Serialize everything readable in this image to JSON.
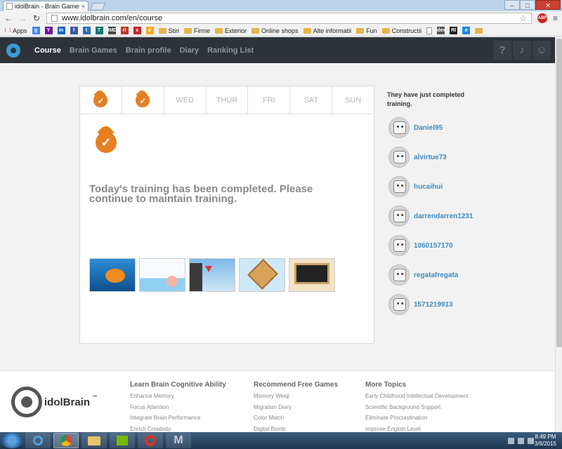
{
  "browser": {
    "tab_title": "idolBrain - Brain Games &",
    "tab_close": "×",
    "url": "www.idolbrain.com/en/course",
    "abp": "ABP",
    "win": {
      "minimize": "–",
      "maximize": "□",
      "close": "✕"
    }
  },
  "bookmarks": [
    {
      "label": "Apps",
      "kind": "apps"
    },
    {
      "label": "",
      "kind": "sq",
      "color": "#4285f4",
      "glyph": "g"
    },
    {
      "label": "",
      "kind": "sq",
      "color": "#6a1b9a",
      "glyph": "Y"
    },
    {
      "label": "",
      "kind": "sq",
      "color": "#1565c0",
      "glyph": "in"
    },
    {
      "label": "",
      "kind": "sq",
      "color": "#3b5998",
      "glyph": "f"
    },
    {
      "label": "",
      "kind": "sq",
      "color": "#2a6ebb",
      "glyph": "t"
    },
    {
      "label": "",
      "kind": "sq",
      "color": "#00796b",
      "glyph": "T"
    },
    {
      "label": "",
      "kind": "sq",
      "color": "#444444",
      "glyph": "IMDb"
    },
    {
      "label": "",
      "kind": "sq",
      "color": "#c0392b",
      "glyph": "rl"
    },
    {
      "label": "",
      "kind": "sq",
      "color": "#c62828",
      "glyph": "x"
    },
    {
      "label": "",
      "kind": "sq",
      "color": "#f9a825",
      "glyph": "e"
    },
    {
      "label": "Stiri",
      "kind": "folder"
    },
    {
      "label": "Firme",
      "kind": "folder"
    },
    {
      "label": "Exterior",
      "kind": "folder"
    },
    {
      "label": "Online shops",
      "kind": "folder"
    },
    {
      "label": "Alte informatii",
      "kind": "folder"
    },
    {
      "label": "Fun",
      "kind": "folder"
    },
    {
      "label": "Constructii",
      "kind": "folder"
    },
    {
      "label": "",
      "kind": "doc"
    },
    {
      "label": "",
      "kind": "sq",
      "color": "#555555",
      "glyph": "dex"
    },
    {
      "label": "",
      "kind": "sq",
      "color": "#222222",
      "glyph": "RI"
    },
    {
      "label": "",
      "kind": "sq",
      "color": "#1e88e5",
      "glyph": "e"
    },
    {
      "label": "",
      "kind": "folder"
    }
  ],
  "nav": {
    "links": [
      "Course",
      "Brain Games",
      "Brain profile",
      "Diary",
      "Ranking List"
    ],
    "help": "?",
    "bell": "♪",
    "profile": "☺"
  },
  "week": [
    {
      "label": "",
      "done": true
    },
    {
      "label": "",
      "done": true
    },
    {
      "label": "WED",
      "done": false
    },
    {
      "label": "THUR",
      "done": false
    },
    {
      "label": "FRI",
      "done": false
    },
    {
      "label": "SAT",
      "done": false
    },
    {
      "label": "SUN",
      "done": false
    }
  ],
  "check_glyph": "✓",
  "message": "Today's training has been completed. Please continue to maintain training.",
  "panel_title": "They have just completed training.",
  "users": [
    "Daniel95",
    "alvirtue73",
    "hucaihui",
    "darrendarren1231",
    "1060157170",
    "regatafregata",
    "1571219913"
  ],
  "footer": {
    "logo": "idolBrain",
    "trademark": "™",
    "columns": [
      {
        "title": "Learn Brain Cognitive Ability",
        "links": [
          "Enhance Memory",
          "Focus Attention",
          "Integrate Brain Performance",
          "Enrich Creativity"
        ]
      },
      {
        "title": "Recommend Free Games",
        "links": [
          "Memory Weiqi",
          "Migration Diary",
          "Color Match",
          "Digital Bomb"
        ]
      },
      {
        "title": "More Topics",
        "links": [
          "Early Childhood Intellectual Development",
          "Scientific Background Support",
          "Eliminate Procrastination",
          "Improve English Level"
        ]
      }
    ]
  },
  "taskbar": {
    "time": "8:49 PM",
    "date": "3/9/2015",
    "m_glyph": "M"
  }
}
